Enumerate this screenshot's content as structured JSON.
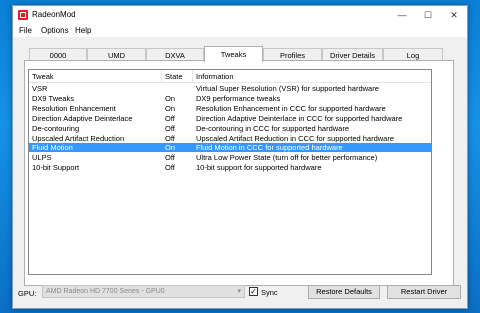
{
  "window": {
    "title": "RadeonMod",
    "minimize": "—",
    "maximize": "☐",
    "close": "✕"
  },
  "menu": [
    "File",
    "Options",
    "Help"
  ],
  "tabs": [
    "0000",
    "UMD",
    "DXVA",
    "Tweaks",
    "Profiles",
    "Driver Details",
    "Log"
  ],
  "active_tab": "Tweaks",
  "table": {
    "headers": [
      "Tweak",
      "State",
      "Information"
    ],
    "rows": [
      {
        "tweak": "VSR",
        "state": "",
        "info": "Virtual Super Resolution (VSR) for supported hardware"
      },
      {
        "tweak": "DX9 Tweaks",
        "state": "On",
        "info": "DX9 performance tweaks"
      },
      {
        "tweak": "Resolution Enhancement",
        "state": "On",
        "info": "Resolution Enhancement in CCC for supported hardware"
      },
      {
        "tweak": "Direction Adaptive Deinterlace",
        "state": "Off",
        "info": "Direction Adaptive Deinterlace in CCC for supported hardware"
      },
      {
        "tweak": "De-contouring",
        "state": "Off",
        "info": "De-contouring in CCC for supported hardware"
      },
      {
        "tweak": "Upscaled Artifact Reduction",
        "state": "Off",
        "info": "Upscaled Artifact Reduction in CCC for supported hardware"
      },
      {
        "tweak": "Fluid Motion",
        "state": "On",
        "info": "Fluid Motion in CCC for supported hardware"
      },
      {
        "tweak": "ULPS",
        "state": "Off",
        "info": "Ultra Low Power State (turn off for better performance)"
      },
      {
        "tweak": "10-bit Support",
        "state": "Off",
        "info": "10-bit support for supported hardware"
      }
    ],
    "selected_row": "Fluid Motion"
  },
  "bottom": {
    "gpu_label": "GPU:",
    "gpu_value": "AMD Radeon HD 7700 Series - GPU0",
    "sync_label": "Sync",
    "sync_checked": true,
    "sync_mark": "✓",
    "restore_label": "Restore Defaults",
    "restart_label": "Restart Driver"
  },
  "colors": {
    "selection": "#3399ff",
    "app_icon": "#d8232a",
    "desktop": "#0a7fd6"
  }
}
